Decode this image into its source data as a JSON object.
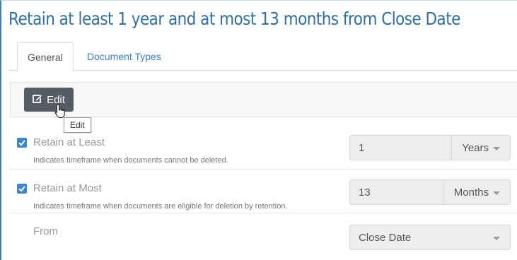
{
  "page": {
    "title": "Retain at least 1 year and at most 13 months from Close Date"
  },
  "tabs": [
    {
      "label": "General",
      "active": true
    },
    {
      "label": "Document Types",
      "active": false
    }
  ],
  "toolbar": {
    "edit_label": "Edit",
    "tooltip": "Edit"
  },
  "fields": {
    "retain_least": {
      "label": "Retain at Least",
      "description": "Indicates timeframe when documents cannot be deleted.",
      "checked": true,
      "value": "1",
      "unit": "Years"
    },
    "retain_most": {
      "label": "Retain at Most",
      "description": "Indicates timeframe when documents are eligible for deletion by retention.",
      "checked": true,
      "value": "13",
      "unit": "Months"
    },
    "from": {
      "label": "From",
      "value": "Close Date"
    }
  },
  "colors": {
    "accent": "#3a86cf",
    "title": "#2f6fa8",
    "button": "#555c63"
  },
  "icons": {
    "edit": "pencil-square-icon",
    "cursor": "hand-pointer-icon",
    "checkbox": "checkmark-icon",
    "dropdown": "caret-down-icon"
  }
}
